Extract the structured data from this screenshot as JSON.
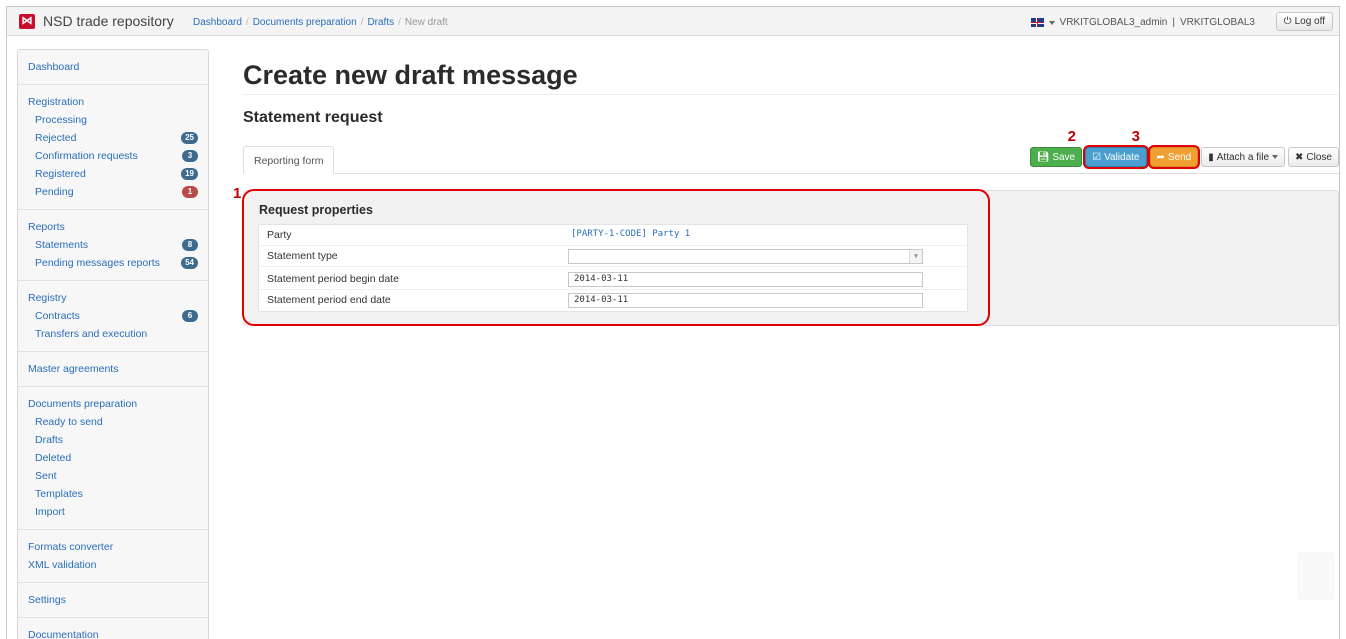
{
  "app": {
    "brand": "NSD trade repository",
    "logo_glyph": "⋈"
  },
  "breadcrumb": [
    {
      "label": "Dashboard"
    },
    {
      "label": "Documents preparation"
    },
    {
      "label": "Drafts"
    },
    {
      "label": "New draft"
    }
  ],
  "user": {
    "account": "VRKITGLOBAL3_admin",
    "org": "VRKITGLOBAL3",
    "separator": "|",
    "logoff_label": "Log off"
  },
  "sidebar": {
    "groups": [
      {
        "head": "Dashboard",
        "items": []
      },
      {
        "head": "Registration",
        "items": [
          {
            "label": "Processing"
          },
          {
            "label": "Rejected",
            "badge": "25"
          },
          {
            "label": "Confirmation requests",
            "badge": "3"
          },
          {
            "label": "Registered",
            "badge": "19"
          },
          {
            "label": "Pending",
            "badge": "1"
          }
        ]
      },
      {
        "head": "Reports",
        "items": [
          {
            "label": "Statements",
            "badge": "8"
          },
          {
            "label": "Pending messages reports",
            "badge": "54"
          }
        ]
      },
      {
        "head": "Registry",
        "items": [
          {
            "label": "Contracts",
            "badge": "6"
          },
          {
            "label": "Transfers and execution"
          }
        ]
      },
      {
        "head": "Master agreements",
        "items": []
      },
      {
        "head": "Documents preparation",
        "items": [
          {
            "label": "Ready to send"
          },
          {
            "label": "Drafts"
          },
          {
            "label": "Deleted"
          },
          {
            "label": "Sent"
          },
          {
            "label": "Templates"
          },
          {
            "label": "Import"
          }
        ]
      },
      {
        "head": "Formats converter",
        "items": [],
        "extra": "XML validation"
      },
      {
        "head": "Settings",
        "items": []
      },
      {
        "head": "Documentation",
        "items": []
      }
    ]
  },
  "main": {
    "title": "Create new draft message",
    "subtitle": "Statement request",
    "tab": "Reporting form",
    "toolbar": {
      "save": "Save",
      "validate": "Validate",
      "send": "Send",
      "attach": "Attach a file",
      "close": "Close"
    },
    "callouts": {
      "one": "1",
      "two": "2",
      "three": "3"
    },
    "panel": {
      "title": "Request properties",
      "rows": {
        "party_label": "Party",
        "party_value": "[PARTY-1-CODE] Party 1",
        "type_label": "Statement type",
        "type_value": "",
        "begin_label": "Statement period begin date",
        "begin_value": "2014-03-11",
        "end_label": "Statement period end date",
        "end_value": "2014-03-11"
      }
    }
  },
  "colors": {
    "brand_red": "#c8102e",
    "link": "#2a6ebb",
    "save": "#4cae4c",
    "validate": "#4a9fd0",
    "send": "#f0a030",
    "highlight": "#e00000"
  }
}
